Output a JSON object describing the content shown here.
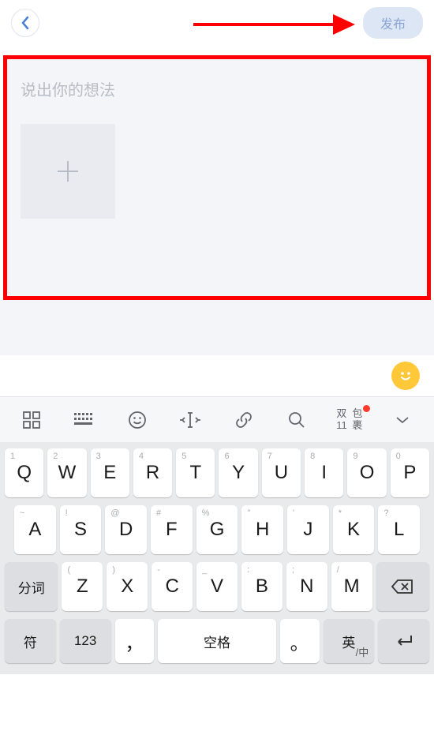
{
  "header": {
    "publish_label": "发布"
  },
  "compose": {
    "placeholder": "说出你的想法"
  },
  "toolbar": {
    "package_line1": "双11",
    "package_line2": "包裹"
  },
  "keyboard": {
    "row1": [
      {
        "sup": "1",
        "main": "Q"
      },
      {
        "sup": "2",
        "main": "W"
      },
      {
        "sup": "3",
        "main": "E"
      },
      {
        "sup": "4",
        "main": "R"
      },
      {
        "sup": "5",
        "main": "T"
      },
      {
        "sup": "6",
        "main": "Y"
      },
      {
        "sup": "7",
        "main": "U"
      },
      {
        "sup": "8",
        "main": "I"
      },
      {
        "sup": "9",
        "main": "O"
      },
      {
        "sup": "0",
        "main": "P"
      }
    ],
    "row2": [
      {
        "sup": "~",
        "main": "A"
      },
      {
        "sup": "!",
        "main": "S"
      },
      {
        "sup": "@",
        "main": "D"
      },
      {
        "sup": "#",
        "main": "F"
      },
      {
        "sup": "%",
        "main": "G"
      },
      {
        "sup": "\"",
        "main": "H"
      },
      {
        "sup": "'",
        "main": "J"
      },
      {
        "sup": "*",
        "main": "K"
      },
      {
        "sup": "?",
        "main": "L"
      }
    ],
    "row3": {
      "segment_label": "分词",
      "keys": [
        {
          "sup": "(",
          "main": "Z"
        },
        {
          "sup": ")",
          "main": "X"
        },
        {
          "sup": "-",
          "main": "C"
        },
        {
          "sup": "_",
          "main": "V"
        },
        {
          "sup": ":",
          "main": "B"
        },
        {
          "sup": ";",
          "main": "N"
        },
        {
          "sup": "/",
          "main": "M"
        }
      ]
    },
    "row4": {
      "symbol_label": "符",
      "number_label": "123",
      "comma": "，",
      "space_label": "空格",
      "period": "。",
      "lang_main": "英",
      "lang_sub": "中"
    }
  }
}
